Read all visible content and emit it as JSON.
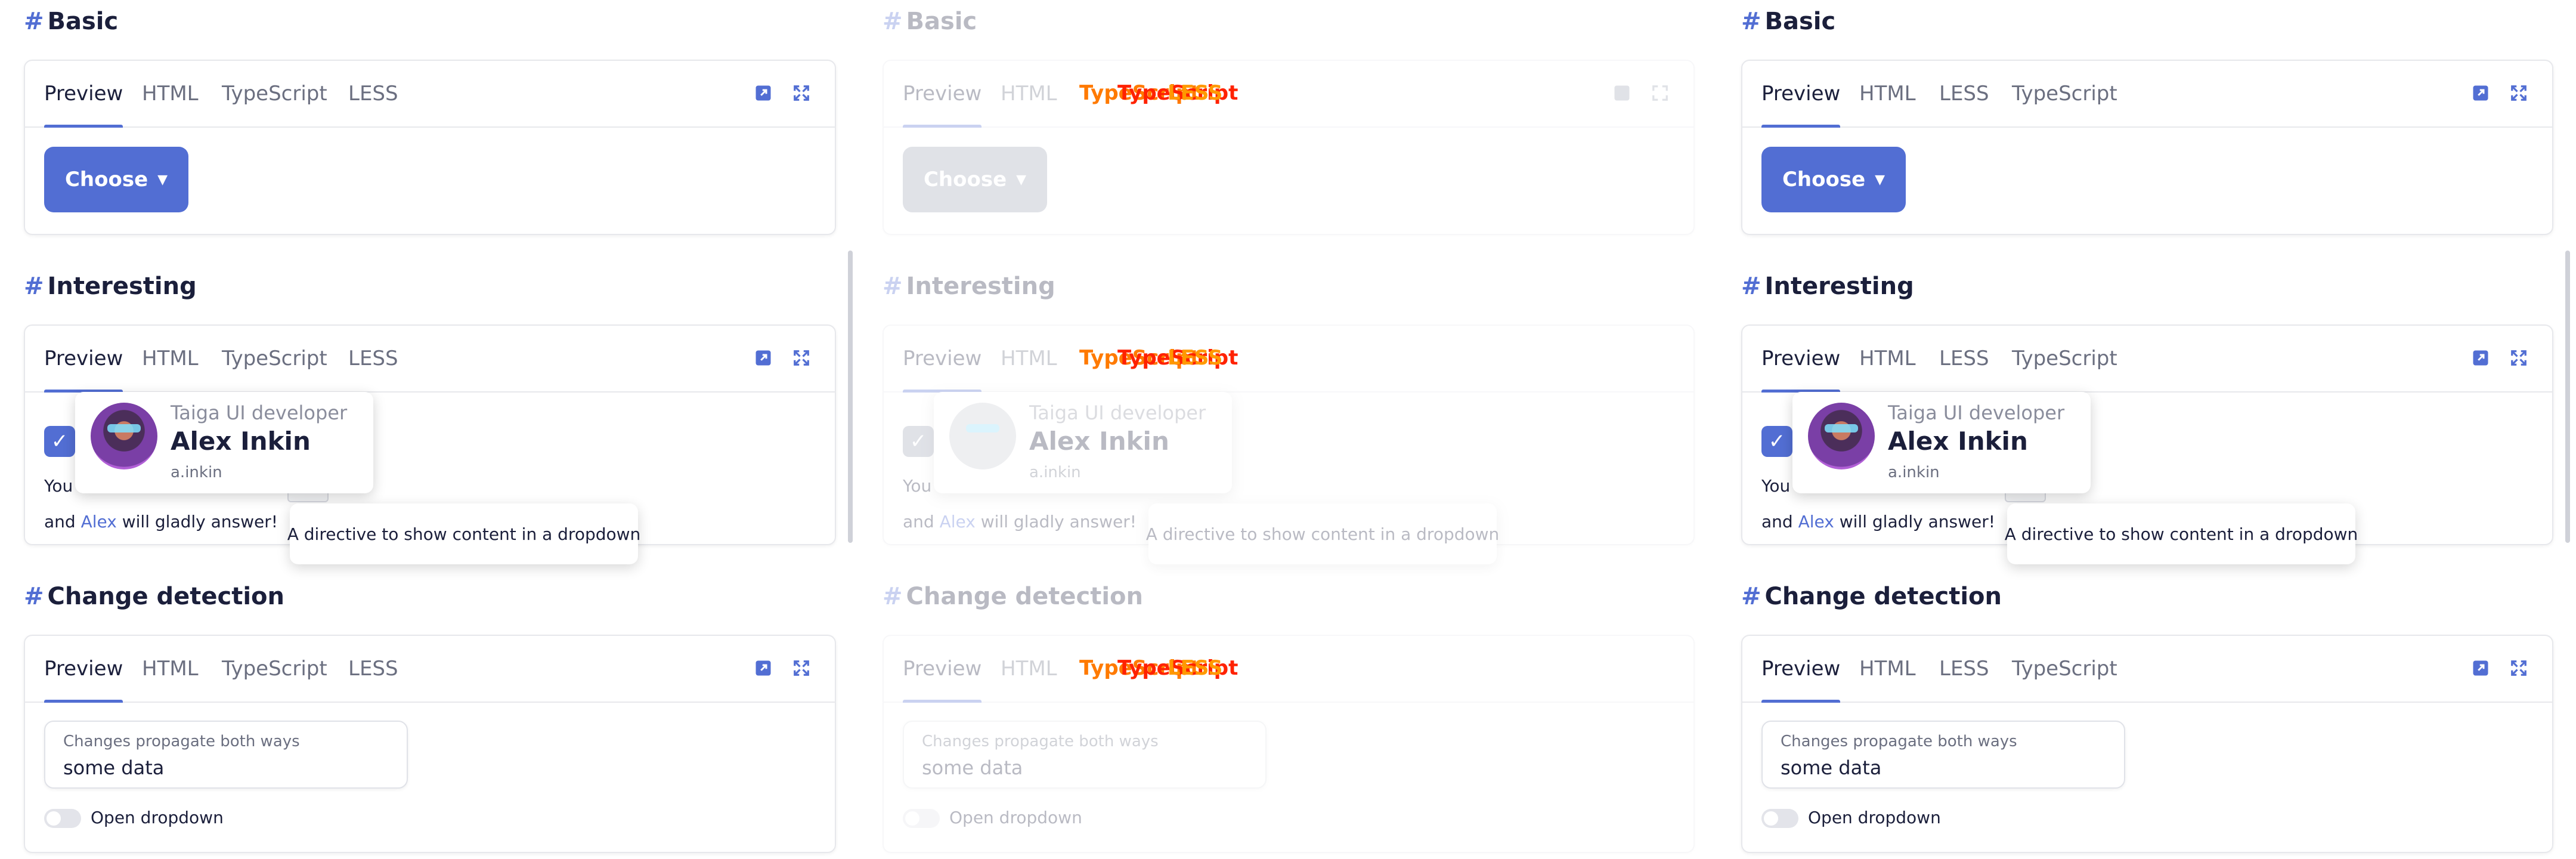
{
  "sections": [
    {
      "title": "Basic"
    },
    {
      "title": "Interesting"
    },
    {
      "title": "Change detection"
    }
  ],
  "tabs_ts_first": [
    "Preview",
    "HTML",
    "TypeScript",
    "LESS"
  ],
  "tabs_less_first": [
    "Preview",
    "HTML",
    "LESS",
    "TypeScript"
  ],
  "icons": {
    "open_in_new": "open-in-new-icon",
    "fullscreen": "fullscreen-icon",
    "chevron": "chevron-down-icon",
    "check": "check-icon"
  },
  "basic": {
    "choose_label": "Choose"
  },
  "interesting": {
    "text_before": "You",
    "text_line2_prefix": "and",
    "text_link": "Alex",
    "text_line2_suffix": "will gladly answer!",
    "kbd_text": "own",
    "profile": {
      "role": "Taiga UI developer",
      "name": "Alex Inkin",
      "login": "a.inkin"
    },
    "tooltip": "A directive to show content in a dropdown"
  },
  "change_detection": {
    "field_label": "Changes propagate both ways",
    "field_value": "some data",
    "toggle_label": "Open dropdown"
  },
  "glitch_text": {
    "a": "TypeScript",
    "b": "TypeScript",
    "c": "LESS"
  },
  "colors": {
    "accent": "#526ed3",
    "text": "#1b1f3b",
    "muted": "#6b6f80",
    "glitch": "#ff7a00"
  }
}
